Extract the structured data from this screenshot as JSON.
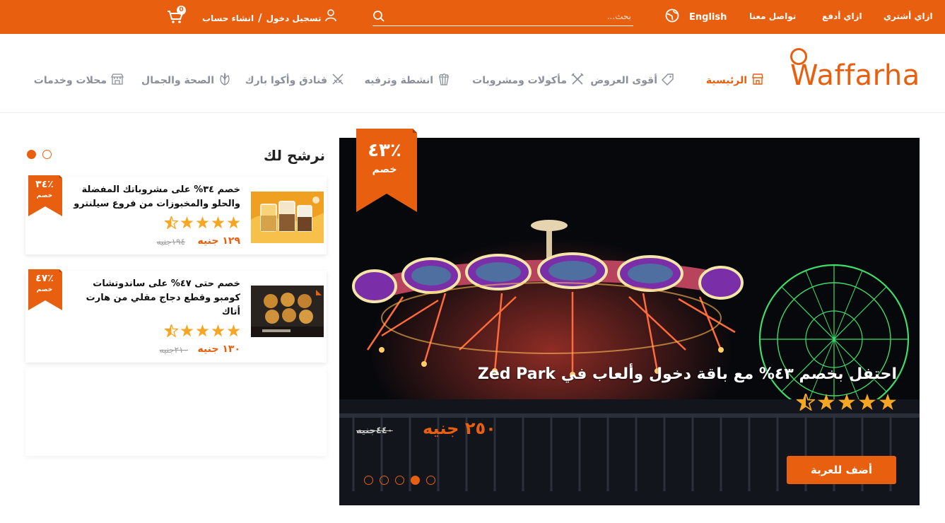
{
  "topbar": {
    "how_buy": "ازاي أشتري",
    "how_pay": "ازاي أدفع",
    "contact": "تواصل معنا",
    "language": "English",
    "search_placeholder": "بحث...",
    "login": "تسجيل دخول",
    "separator": "/",
    "signup": "انشاء حساب",
    "cart_count": "0"
  },
  "logo": {
    "text": "Waffarha"
  },
  "nav": {
    "items": [
      {
        "label": "الرئيسية",
        "icon": "store-icon"
      },
      {
        "label": "أقوى العروض",
        "icon": "tag-icon"
      },
      {
        "label": "مأكولات ومشروبات",
        "icon": "utensils-icon"
      },
      {
        "label": "انشطة وترفيه",
        "icon": "popcorn-icon"
      },
      {
        "label": "فنادق وأكوا بارك",
        "icon": "swords-icon"
      },
      {
        "label": "الصحة والجمال",
        "icon": "leaf-icon"
      },
      {
        "label": "محلات وخدمات",
        "icon": "shop-icon"
      }
    ]
  },
  "hero": {
    "discount_percent": "٤٣٪",
    "discount_label": "خصم",
    "title": "احتفل بخصم ٤٣% مع باقة دخول وألعاب في Zed Park",
    "rating": 4.5,
    "price": "٢٥٠ جنيه",
    "old_price": "٤٤٠جنيه",
    "cta": "أضف للعربة",
    "slides": 5,
    "active_slide": 4
  },
  "sidebar": {
    "title": "نرشح لك",
    "pages": 2,
    "active_page": 1,
    "cards": [
      {
        "discount_percent": "٣٤٪",
        "discount_label": "خصم",
        "title": "خصم ٣٤% على مشروباتك المفضلة والحلو والمخبوزات من فروع سيلنترو",
        "rating": 4.5,
        "price": "١٢٩ جنيه",
        "old_price": "١٩٤جنيه"
      },
      {
        "discount_percent": "٤٧٪",
        "discount_label": "خصم",
        "title": "خصم حتى ٤٧% على ساندوتشات كومبو وقطع دجاج مقلي من هارت أتاك",
        "rating": 4.5,
        "price": "١٣٠ جنيه",
        "old_price": "٢١٠جنيه"
      }
    ]
  },
  "colors": {
    "brand": "#e8600f",
    "star": "#f5a623",
    "nav_text": "#8a8f99"
  }
}
